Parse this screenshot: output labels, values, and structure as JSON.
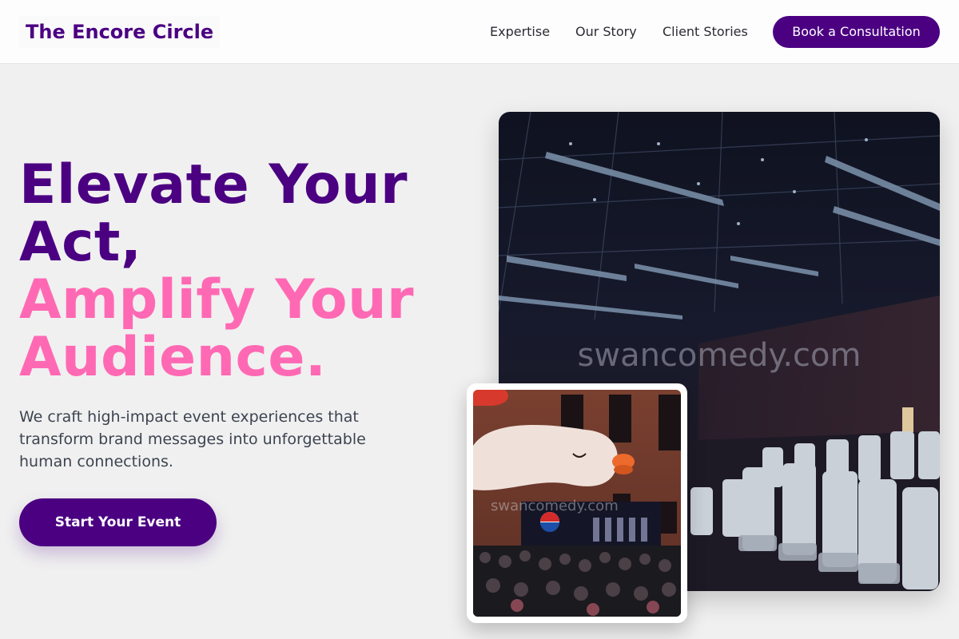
{
  "header": {
    "logo": "The Encore Circle",
    "nav": [
      "Expertise",
      "Our Story",
      "Client Stories"
    ],
    "cta": "Book a Consultation"
  },
  "hero": {
    "headline_line1": "Elevate Your",
    "headline_line2": "Act,",
    "headline_line3": "Amplify Your",
    "headline_line4": "Audience.",
    "subtext": "We craft high-impact event experiences that transform brand messages into unforgettable human connections.",
    "cta": "Start Your Event"
  },
  "images": {
    "main_watermark": "swancomedy.com",
    "inset_watermark": "swancomedy.com",
    "inset_sign": "PEPSI"
  },
  "colors": {
    "brand_purple": "#4b0082",
    "accent_pink": "#ff69b4"
  }
}
